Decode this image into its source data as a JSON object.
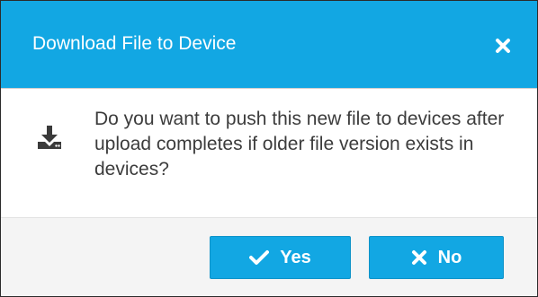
{
  "dialog": {
    "title": "Download File to Device",
    "close_icon": "close-icon",
    "message": "Do you want to push this new file to devices after upload completes if older file version exists in devices?",
    "message_icon": "download-icon",
    "buttons": {
      "yes_label": "Yes",
      "yes_icon": "check-icon",
      "no_label": "No",
      "no_icon": "close-icon"
    }
  },
  "colors": {
    "header_bg": "#12a7e3",
    "button_bg": "#12a7e3",
    "footer_bg": "#f4f4f4",
    "text": "#3c3c3c"
  }
}
